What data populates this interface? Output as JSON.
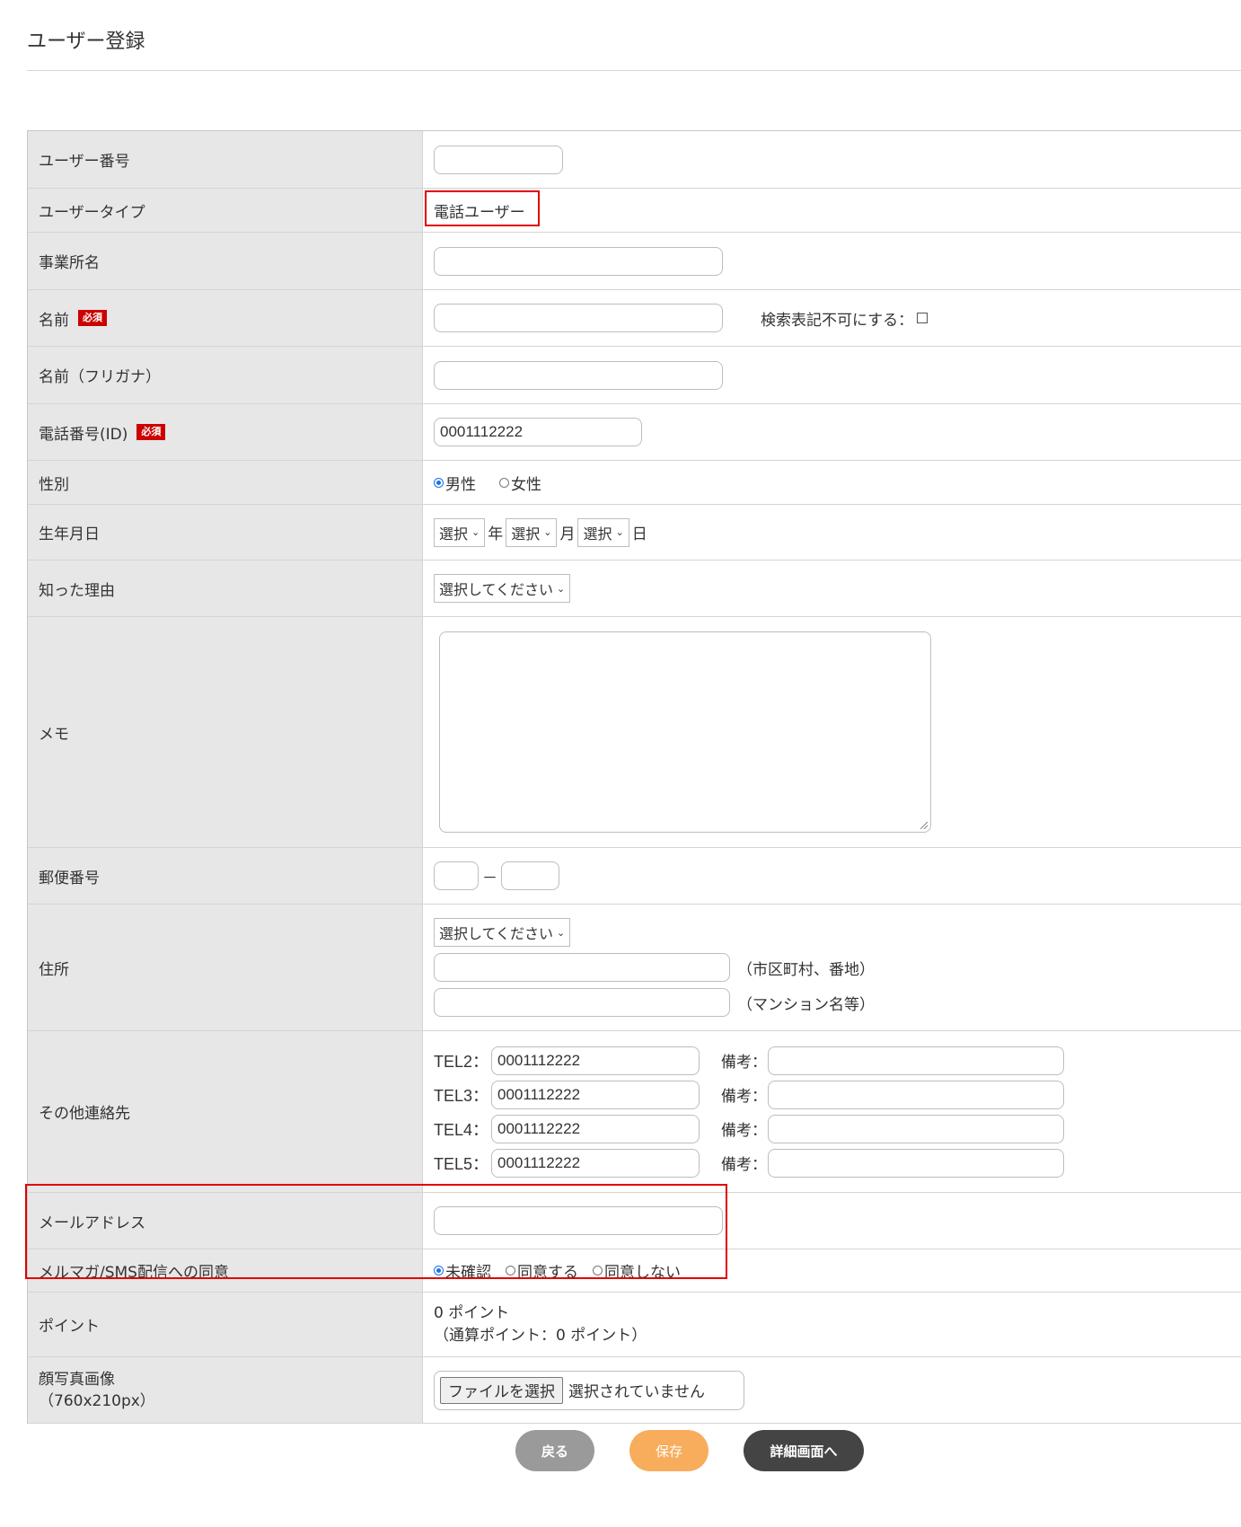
{
  "page_title": "ユーザー登録",
  "fields": {
    "user_number": {
      "label": "ユーザー番号",
      "value": ""
    },
    "user_type": {
      "label": "ユーザータイプ",
      "value": "電話ユーザー"
    },
    "office_name": {
      "label": "事業所名",
      "value": ""
    },
    "name": {
      "label": "名前",
      "required_badge": "必須",
      "value": "",
      "search_hidden_label": "検索表記不可にする：",
      "search_hidden_checked": false
    },
    "name_kana": {
      "label": "名前（フリガナ）",
      "value": ""
    },
    "phone_id": {
      "label": "電話番号(ID)",
      "required_badge": "必須",
      "value": "0001112222"
    },
    "gender": {
      "label": "性別",
      "options": [
        "男性",
        "女性"
      ],
      "selected": "男性"
    },
    "birthdate": {
      "label": "生年月日",
      "year_select": "選択",
      "year_unit": "年",
      "month_select": "選択",
      "month_unit": "月",
      "day_select": "選択",
      "day_unit": "日"
    },
    "referral": {
      "label": "知った理由",
      "select": "選択してください"
    },
    "memo": {
      "label": "メモ",
      "value": ""
    },
    "postal_code": {
      "label": "郵便番号",
      "separator": "－",
      "first": "",
      "second": ""
    },
    "address": {
      "label": "住所",
      "prefecture_select": "選択してください",
      "line1_hint": "（市区町村、番地）",
      "line2_hint": "（マンション名等）",
      "line1": "",
      "line2": ""
    },
    "other_contacts": {
      "label": "その他連絡先",
      "note_label": "備考：",
      "items": [
        {
          "label": "TEL2：",
          "value": "0001112222",
          "note": ""
        },
        {
          "label": "TEL3：",
          "value": "0001112222",
          "note": ""
        },
        {
          "label": "TEL4：",
          "value": "0001112222",
          "note": ""
        },
        {
          "label": "TEL5：",
          "value": "0001112222",
          "note": ""
        }
      ]
    },
    "email": {
      "label": "メールアドレス",
      "value": ""
    },
    "newsletter_consent": {
      "label": "メルマガ/SMS配信への同意",
      "options": [
        "未確認",
        "同意する",
        "同意しない"
      ],
      "selected": "未確認"
    },
    "points": {
      "label": "ポイント",
      "line1": "0 ポイント",
      "line2": "（通算ポイント：0 ポイント）"
    },
    "photo": {
      "label_line1": "顔写真画像",
      "label_line2": "（760x210px）",
      "file_button": "ファイルを選択",
      "file_status": "選択されていません"
    }
  },
  "buttons": {
    "back": "戻る",
    "save": "保存",
    "detail": "詳細画面へ"
  },
  "colors": {
    "required_badge": "#cc0000",
    "highlight_border": "#e00000",
    "label_bg": "#e7e7e7",
    "save_button": "#f8ad5c",
    "back_button": "#9a9a9a",
    "detail_button": "#444444"
  }
}
